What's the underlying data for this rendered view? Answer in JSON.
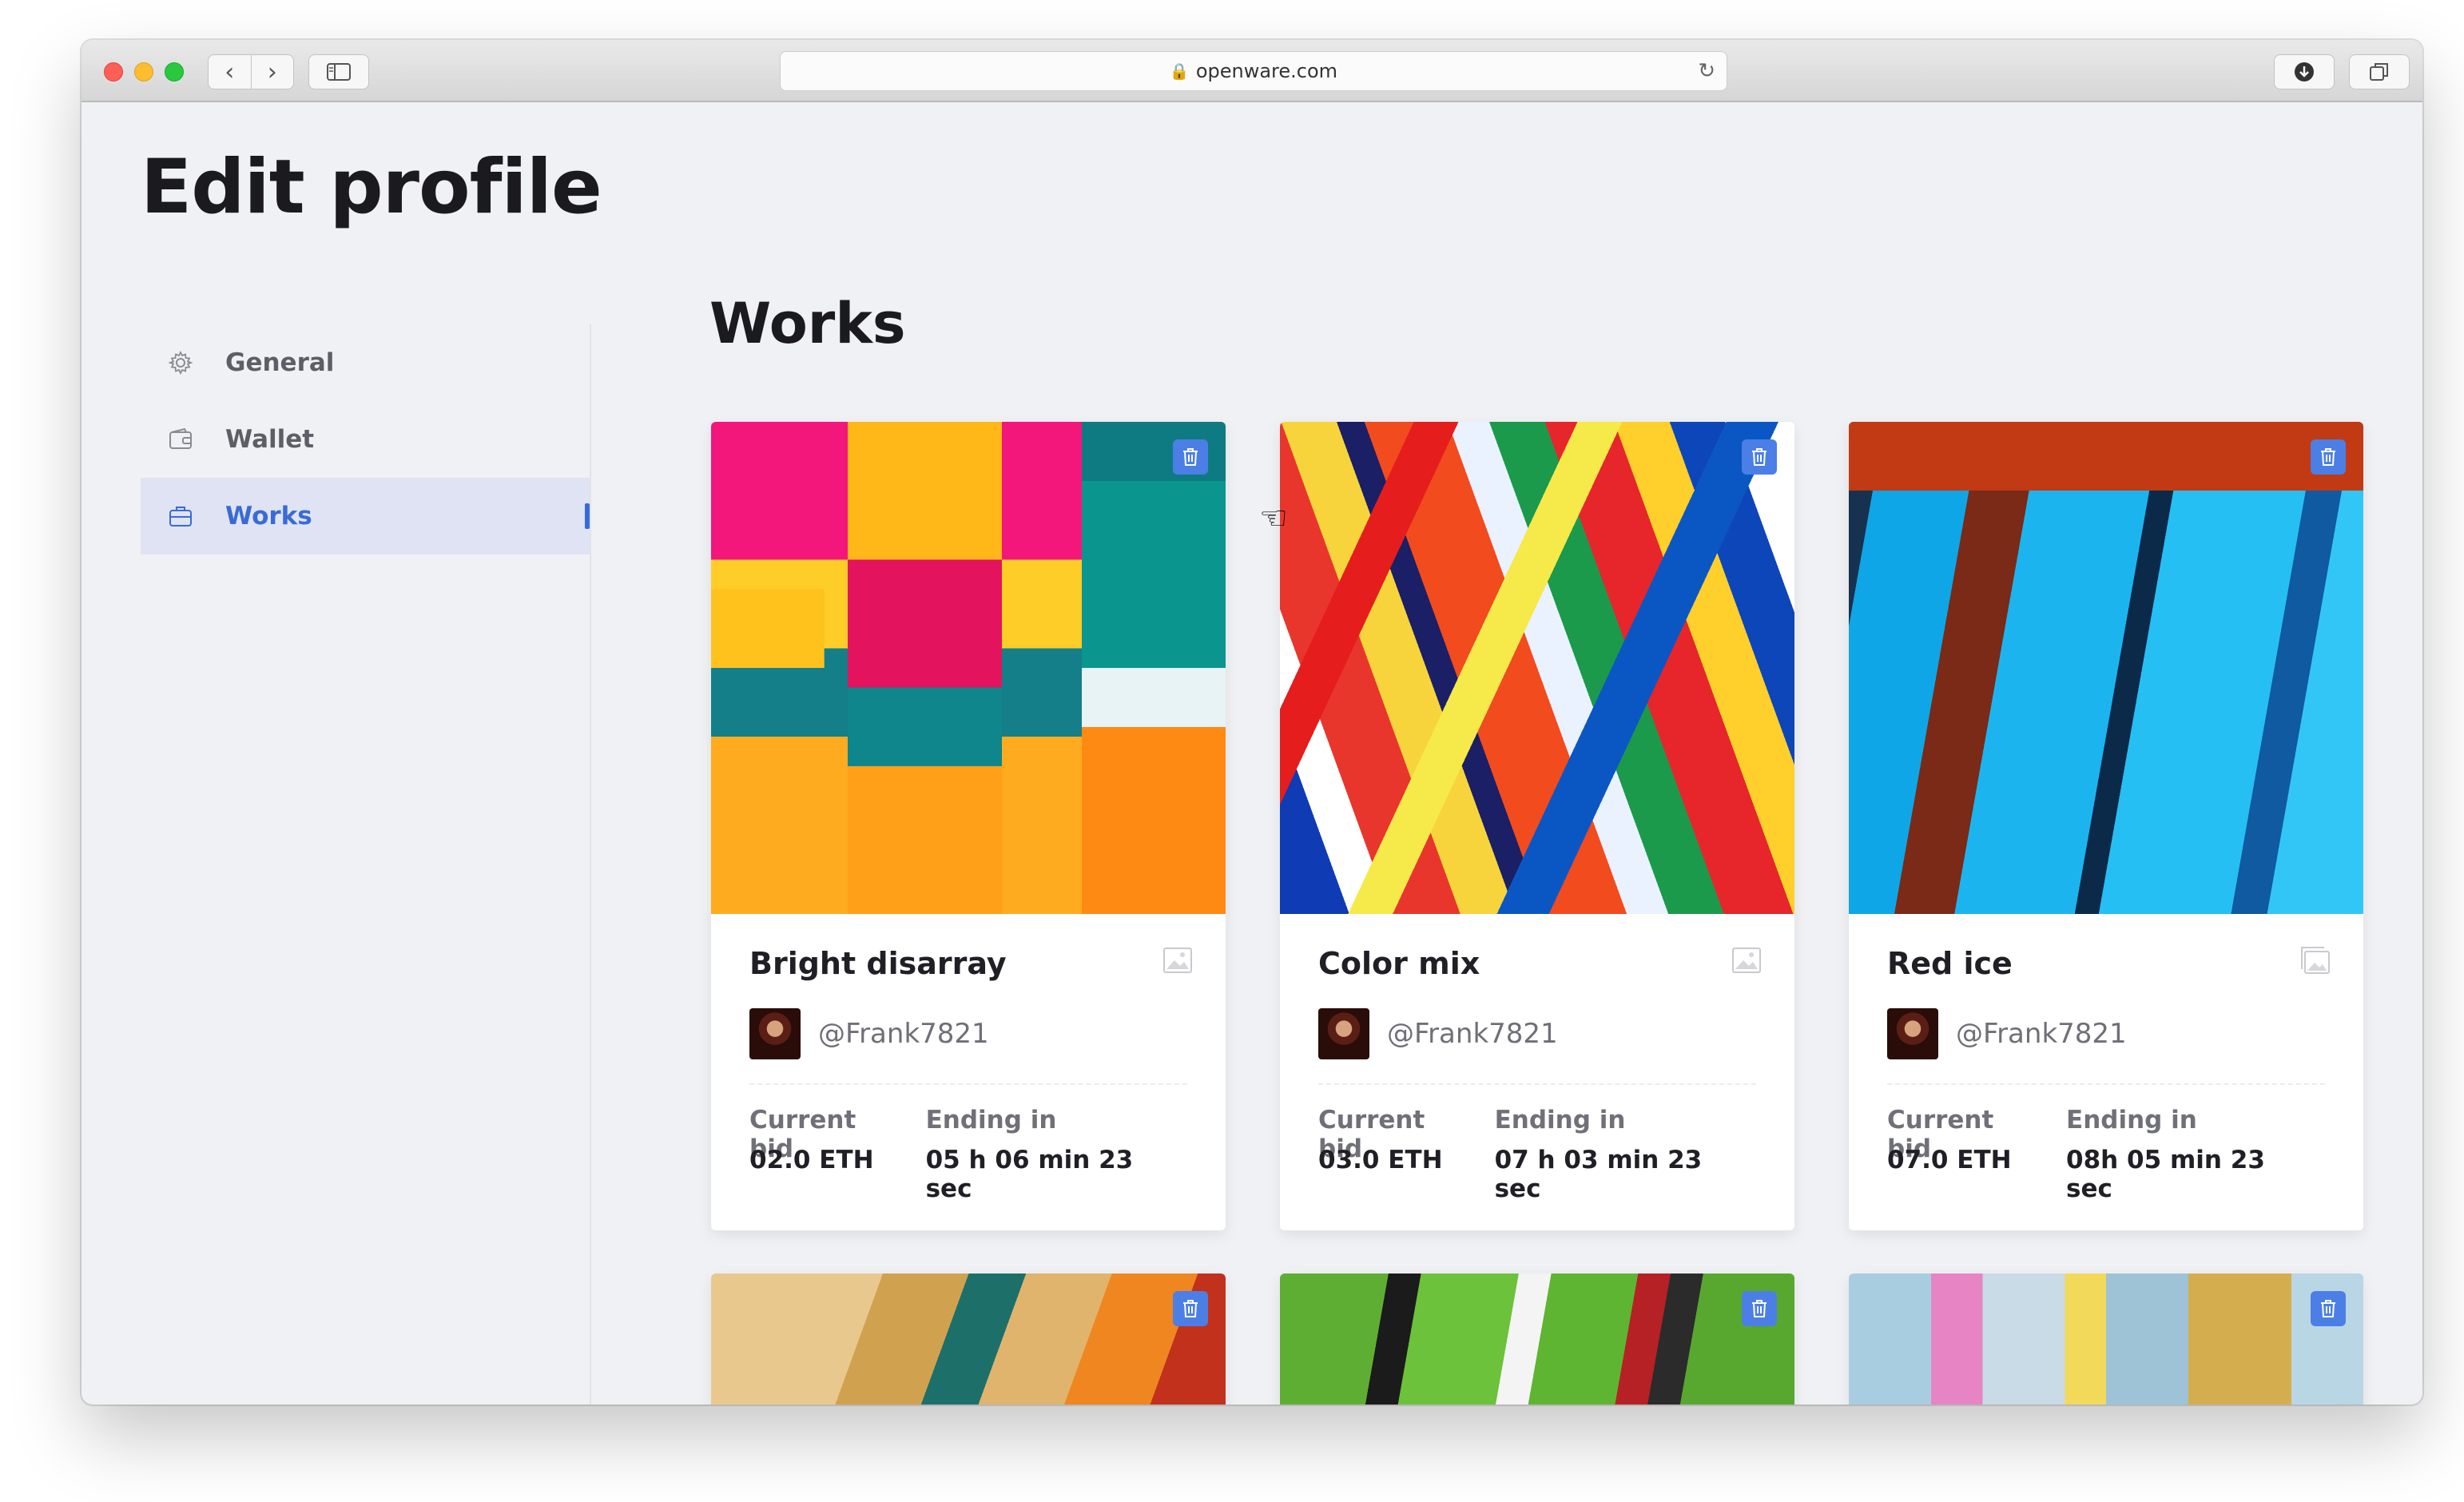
{
  "browser": {
    "url": "openware.com"
  },
  "page": {
    "title": "Edit profile"
  },
  "sidebar": {
    "items": [
      {
        "label": "General",
        "icon": "gear-icon",
        "active": false
      },
      {
        "label": "Wallet",
        "icon": "wallet-icon",
        "active": false
      },
      {
        "label": "Works",
        "icon": "briefcase-icon",
        "active": true
      }
    ]
  },
  "section": {
    "title": "Works"
  },
  "colors": {
    "accent": "#3a6bd4",
    "trash_button": "#4b7fe6",
    "background": "#f0f1f4"
  },
  "labels": {
    "current_bid": "Current bid",
    "ending_in": "Ending in"
  },
  "works": [
    {
      "title": "Bright disarray",
      "author": "@Frank7821",
      "current_bid": "02.0 ETH",
      "ending_in": "05 h 06 min 23 sec"
    },
    {
      "title": "Color mix",
      "author": "@Frank7821",
      "current_bid": "03.0 ETH",
      "ending_in": "07 h 03 min 23 sec"
    },
    {
      "title": "Red ice",
      "author": "@Frank7821",
      "current_bid": "07.0 ETH",
      "ending_in": "08h 05 min 23 sec"
    }
  ]
}
